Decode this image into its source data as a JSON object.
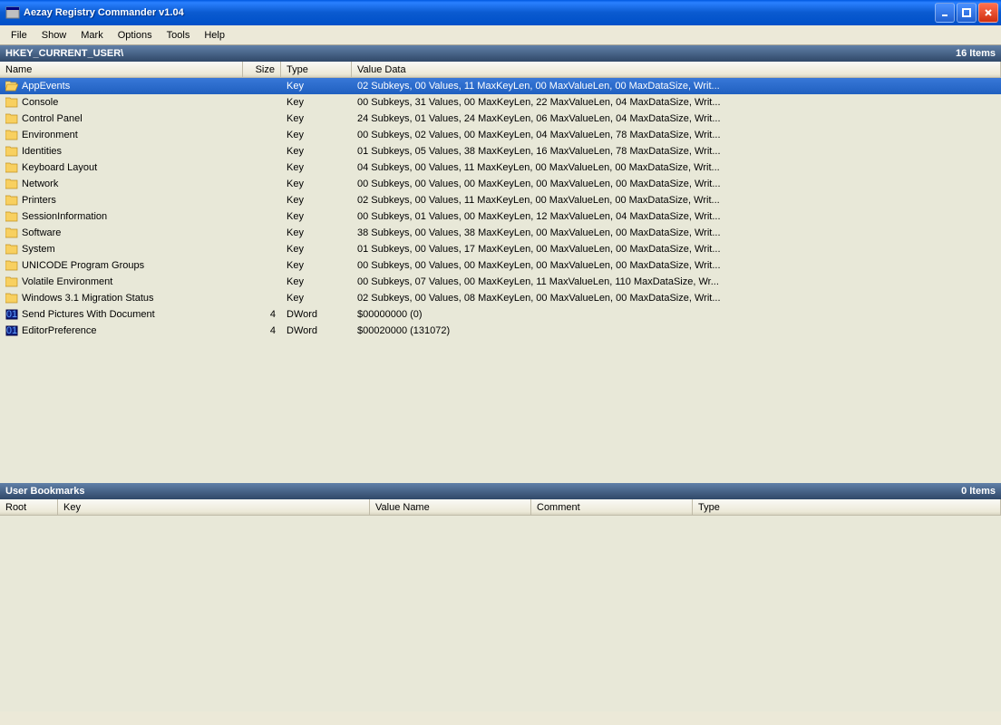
{
  "titlebar": {
    "title": "Aezay Registry Commander v1.04"
  },
  "menu": {
    "file": "File",
    "show": "Show",
    "mark": "Mark",
    "options": "Options",
    "tools": "Tools",
    "help": "Help"
  },
  "main_header": {
    "path": "HKEY_CURRENT_USER\\",
    "count": "16 Items"
  },
  "main_cols": {
    "name": "Name",
    "size": "Size",
    "type": "Type",
    "value": "Value Data"
  },
  "rows": [
    {
      "icon": "folder-open",
      "name": "AppEvents",
      "size": "",
      "type": "Key",
      "value": "02 Subkeys,  00 Values,  11 MaxKeyLen,  00 MaxValueLen,  00 MaxDataSize,  Writ...",
      "selected": true
    },
    {
      "icon": "folder",
      "name": "Console",
      "size": "",
      "type": "Key",
      "value": "00 Subkeys,  31 Values,  00 MaxKeyLen,  22 MaxValueLen,  04 MaxDataSize,  Writ..."
    },
    {
      "icon": "folder",
      "name": "Control Panel",
      "size": "",
      "type": "Key",
      "value": "24 Subkeys,  01 Values,  24 MaxKeyLen,  06 MaxValueLen,  04 MaxDataSize,  Writ..."
    },
    {
      "icon": "folder",
      "name": "Environment",
      "size": "",
      "type": "Key",
      "value": "00 Subkeys,  02 Values,  00 MaxKeyLen,  04 MaxValueLen,  78 MaxDataSize,  Writ..."
    },
    {
      "icon": "folder",
      "name": "Identities",
      "size": "",
      "type": "Key",
      "value": "01 Subkeys,  05 Values,  38 MaxKeyLen,  16 MaxValueLen,  78 MaxDataSize,  Writ..."
    },
    {
      "icon": "folder",
      "name": "Keyboard Layout",
      "size": "",
      "type": "Key",
      "value": "04 Subkeys,  00 Values,  11 MaxKeyLen,  00 MaxValueLen,  00 MaxDataSize,  Writ..."
    },
    {
      "icon": "folder",
      "name": "Network",
      "size": "",
      "type": "Key",
      "value": "00 Subkeys,  00 Values,  00 MaxKeyLen,  00 MaxValueLen,  00 MaxDataSize,  Writ..."
    },
    {
      "icon": "folder",
      "name": "Printers",
      "size": "",
      "type": "Key",
      "value": "02 Subkeys,  00 Values,  11 MaxKeyLen,  00 MaxValueLen,  00 MaxDataSize,  Writ..."
    },
    {
      "icon": "folder",
      "name": "SessionInformation",
      "size": "",
      "type": "Key",
      "value": "00 Subkeys,  01 Values,  00 MaxKeyLen,  12 MaxValueLen,  04 MaxDataSize,  Writ..."
    },
    {
      "icon": "folder",
      "name": "Software",
      "size": "",
      "type": "Key",
      "value": "38 Subkeys,  00 Values,  38 MaxKeyLen,  00 MaxValueLen,  00 MaxDataSize,  Writ..."
    },
    {
      "icon": "folder",
      "name": "System",
      "size": "",
      "type": "Key",
      "value": "01 Subkeys,  00 Values,  17 MaxKeyLen,  00 MaxValueLen,  00 MaxDataSize,  Writ..."
    },
    {
      "icon": "folder",
      "name": "UNICODE Program Groups",
      "size": "",
      "type": "Key",
      "value": "00 Subkeys,  00 Values,  00 MaxKeyLen,  00 MaxValueLen,  00 MaxDataSize,  Writ..."
    },
    {
      "icon": "folder",
      "name": "Volatile Environment",
      "size": "",
      "type": "Key",
      "value": "00 Subkeys,  07 Values,  00 MaxKeyLen,  11 MaxValueLen,  110 MaxDataSize,  Wr..."
    },
    {
      "icon": "folder",
      "name": "Windows 3.1 Migration Status",
      "size": "",
      "type": "Key",
      "value": "02 Subkeys,  00 Values,  08 MaxKeyLen,  00 MaxValueLen,  00 MaxDataSize,  Writ..."
    },
    {
      "icon": "value",
      "name": "Send Pictures With Document",
      "size": "4",
      "type": "DWord",
      "value": "$00000000  (0)"
    },
    {
      "icon": "value",
      "name": "EditorPreference",
      "size": "4",
      "type": "DWord",
      "value": "$00020000  (131072)"
    }
  ],
  "bm_header": {
    "title": "User Bookmarks",
    "count": "0 Items"
  },
  "bm_cols": {
    "root": "Root",
    "key": "Key",
    "valname": "Value Name",
    "comment": "Comment",
    "type": "Type"
  }
}
